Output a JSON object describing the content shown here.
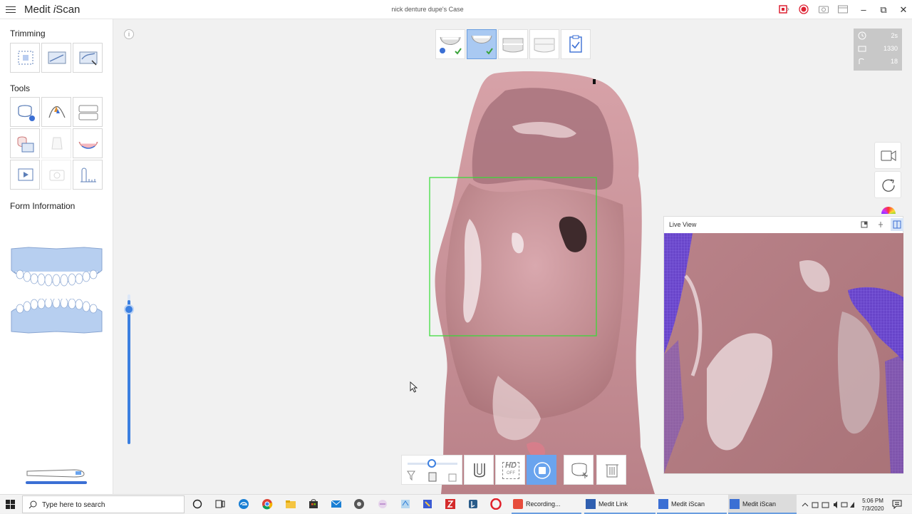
{
  "titlebar": {
    "app_name_prefix": "Medit ",
    "app_name_i": "i",
    "app_name_suffix": "Scan",
    "case_title": "nick denture dupe's Case"
  },
  "left_panel": {
    "trimming_label": "Trimming",
    "tools_label": "Tools",
    "form_info_label": "Form Information"
  },
  "viewport": {
    "info_label": "i",
    "stats": {
      "time": "2s",
      "count": "1330",
      "shots": "18"
    }
  },
  "live_view": {
    "title": "Live View"
  },
  "bottom_toolbar": {
    "hd_label": "HD",
    "hd_state": "OFF"
  },
  "taskbar": {
    "search_placeholder": "Type here to search",
    "apps": [
      {
        "label": "Recording..."
      },
      {
        "label": "Medit Link"
      },
      {
        "label": "Medit iScan"
      },
      {
        "label": "Medit iScan"
      }
    ],
    "time": "5:06 PM",
    "date": "7/3/2020"
  },
  "colors": {
    "accent": "#6aa4ee",
    "active_stage": "#a9c9f2",
    "scan_box": "#33dd33",
    "stats_bg": "#c8c8c8"
  }
}
